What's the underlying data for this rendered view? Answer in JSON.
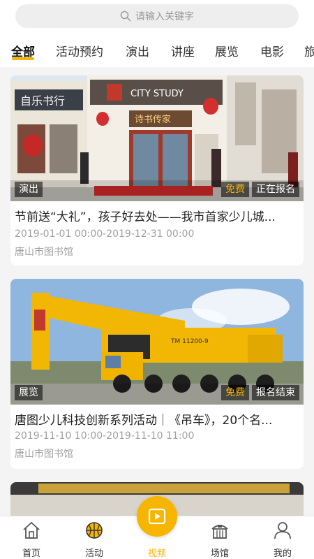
{
  "search": {
    "placeholder": "请输入关键字"
  },
  "tabs": [
    {
      "label": "全部",
      "active": true
    },
    {
      "label": "活动预约"
    },
    {
      "label": "演出"
    },
    {
      "label": "讲座"
    },
    {
      "label": "展览"
    },
    {
      "label": "电影"
    },
    {
      "label": "旅"
    }
  ],
  "cards": [
    {
      "category": "演出",
      "fee": "免费",
      "status": "正在报名",
      "title": "节前送“大礼”，孩子好去处——我市首家少儿城...",
      "time": "2019-01-01 00:00-2019-12-31 00:00",
      "venue": "唐山市图书馆",
      "image_signs": {
        "left_sign": "自乐书行",
        "main_sign": "CITY STUDY",
        "door_sign": "诗书传家"
      }
    },
    {
      "category": "展览",
      "fee": "免费",
      "status": "报名结束",
      "title": "唐图少儿科技创新系列活动｜《吊车》，20个名...",
      "time": "2019-11-10 10:00-2019-11-10 11:00",
      "venue": "唐山市图书馆",
      "image_signs": {
        "crane_label": "TM 11200-9"
      }
    }
  ],
  "nav": [
    {
      "label": "首页",
      "icon": "home-icon"
    },
    {
      "label": "活动",
      "icon": "basketball-icon"
    },
    {
      "label": "视频",
      "icon": "play-icon",
      "active": true
    },
    {
      "label": "场馆",
      "icon": "venue-icon"
    },
    {
      "label": "我的",
      "icon": "user-icon"
    }
  ],
  "colors": {
    "accent": "#f7b500",
    "background": "#f4f4f4",
    "muted_text": "#a0a0a0"
  }
}
